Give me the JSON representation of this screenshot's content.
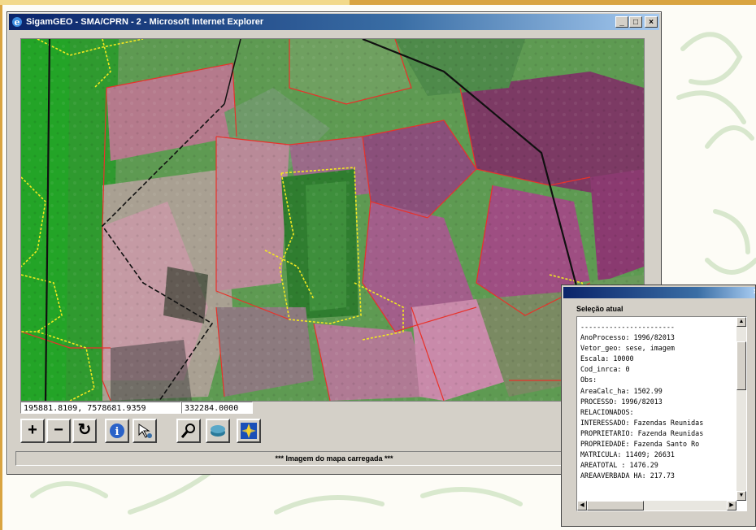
{
  "window": {
    "title": "SigamGEO - SMA/CPRN - 2 - Microsoft Internet Explorer",
    "minimize": "_",
    "maximize": "□",
    "close": "×"
  },
  "coordinates": {
    "xy": "195881.8109, 7578681.9359",
    "scale": "332284.0000"
  },
  "toolbar": {
    "zoom_in": "+",
    "zoom_out": "−",
    "refresh": "↻",
    "info": "i"
  },
  "status_text": "*** Imagem do mapa carregada ***",
  "selection_popup": {
    "heading": "Seleção atual",
    "close": "×",
    "lines": [
      "-----------------------",
      "AnoProcesso: 1996/82013",
      "Vetor_geo: sese, imagem",
      "Escala: 10000",
      "Cod_inrca: 0",
      "Obs:",
      "AreaCalc_ha: 1502.99",
      "PROCESSO: 1996/82013",
      "RELACIONADOS:",
      "INTERESSADO: Fazendas Reunidas",
      "PROPRIETARIO: Fazenda Reunidas",
      "PROPRIEDADE: Fazenda Santo Ro",
      "MATRICULA: 11409; 26631",
      "AREATOTAL : 1476.29",
      "AREAAVERBADA HA: 217.73"
    ]
  },
  "colors": {
    "title_blue": "#0a246a",
    "window_gray": "#d4d0c8",
    "boundary_red": "#e8322a",
    "boundary_yellow": "#f2e820",
    "boundary_black": "#101010",
    "accent_orange": "#d9a441"
  }
}
